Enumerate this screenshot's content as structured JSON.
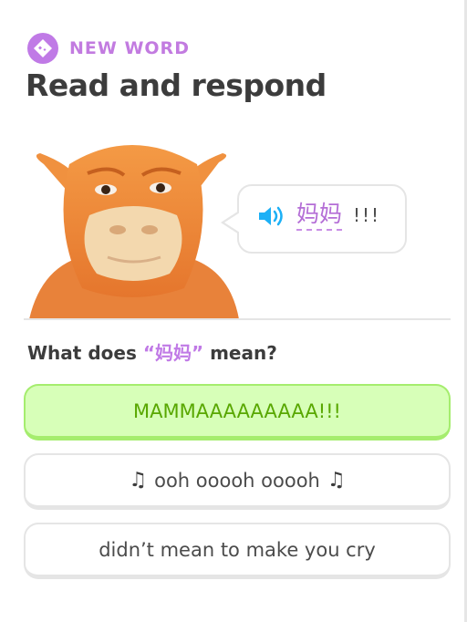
{
  "header": {
    "tag_label": "NEW WORD",
    "tag_icon": "sparkle-diamond-icon",
    "tag_color": "#c07ae6",
    "title": "Read and respond"
  },
  "speech": {
    "speaker_icon": "speaker-icon",
    "word": "妈妈",
    "suffix": "!!!"
  },
  "question": {
    "prefix": "What does ",
    "open_quote": "“",
    "word": "妈妈",
    "close_quote": "”",
    "suffix": " mean?"
  },
  "choices": [
    {
      "label": "MAMMAAAAAAAAA!!!",
      "selected": true
    },
    {
      "label": "ooh ooooh ooooh",
      "note_icon": "music-note-icon",
      "note": "♫",
      "selected": false
    },
    {
      "label": "didn’t mean to make you cry",
      "selected": false
    }
  ],
  "colors": {
    "accent_purple": "#c07ae6",
    "selected_bg": "#d7ffb8",
    "selected_border": "#a5ed6e",
    "selected_text": "#58a700",
    "speaker_blue": "#1cb0f6"
  }
}
